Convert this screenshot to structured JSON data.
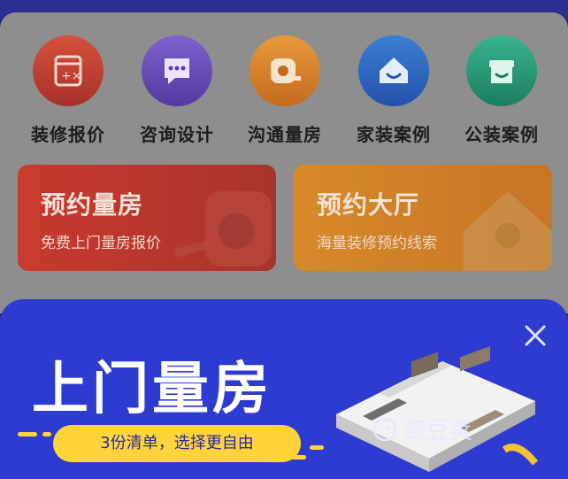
{
  "menu": {
    "items": [
      {
        "label": "装修报价",
        "icon": "calculator-icon",
        "color_top": "#e05a3c",
        "color_bottom": "#b8342a"
      },
      {
        "label": "咨询设计",
        "icon": "chat-bubble-icon",
        "color_top": "#8a6ae0",
        "color_bottom": "#5a3fb8"
      },
      {
        "label": "沟通量房",
        "icon": "tape-measure-icon",
        "color_top": "#f0a040",
        "color_bottom": "#d07020"
      },
      {
        "label": "家装案例",
        "icon": "house-icon",
        "color_top": "#3a8ae0",
        "color_bottom": "#2a5cc0"
      },
      {
        "label": "公装案例",
        "icon": "storefront-icon",
        "color_top": "#3fc09a",
        "color_bottom": "#1f8a6a"
      }
    ]
  },
  "cards": [
    {
      "title": "预约量房",
      "subtitle": "免费上门量房报价",
      "color_left": "#c93a2e",
      "color_right": "#a9332c"
    },
    {
      "title": "预约大厅",
      "subtitle": "海量装修预约线索",
      "color_left": "#d78a2a",
      "color_right": "#c67425"
    }
  ],
  "promo": {
    "headline": "上门量房",
    "pill_text": "3份清单，选择更自由",
    "watermark": "豌豆荚",
    "background": "#2d3bd1",
    "accent": "#ffd43b"
  }
}
